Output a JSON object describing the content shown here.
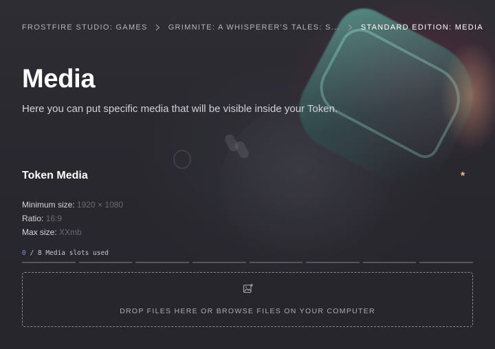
{
  "breadcrumb": {
    "items": [
      {
        "label": "FROSTFIRE STUDIO: GAMES"
      },
      {
        "label": "GRIMNITE: A WHISPERER'S TALES: S..."
      },
      {
        "label": "STANDARD EDITION: MEDIA"
      }
    ],
    "separator_icon": "chevron-right-icon"
  },
  "page": {
    "title": "Media",
    "subtitle": "Here you can put specific media that will be visible inside your Token."
  },
  "token_media": {
    "title": "Token Media",
    "required_mark": "*",
    "required_color": "#f6b987",
    "specs": {
      "min_label": "Minimum size:",
      "min_value": "1920 × 1080",
      "ratio_label": "Ratio:",
      "ratio_value": "16:9",
      "max_label": "Max size:",
      "max_value": "XXmb"
    },
    "slots": {
      "used": "0",
      "separator": "/",
      "total": "8",
      "label": "Media slots used",
      "used_color": "#8a86f0",
      "count": 8
    },
    "dropzone": {
      "icon": "add-image-icon",
      "text": "DROP FILES HERE OR BROWSE FILES ON YOUR COMPUTER"
    }
  }
}
